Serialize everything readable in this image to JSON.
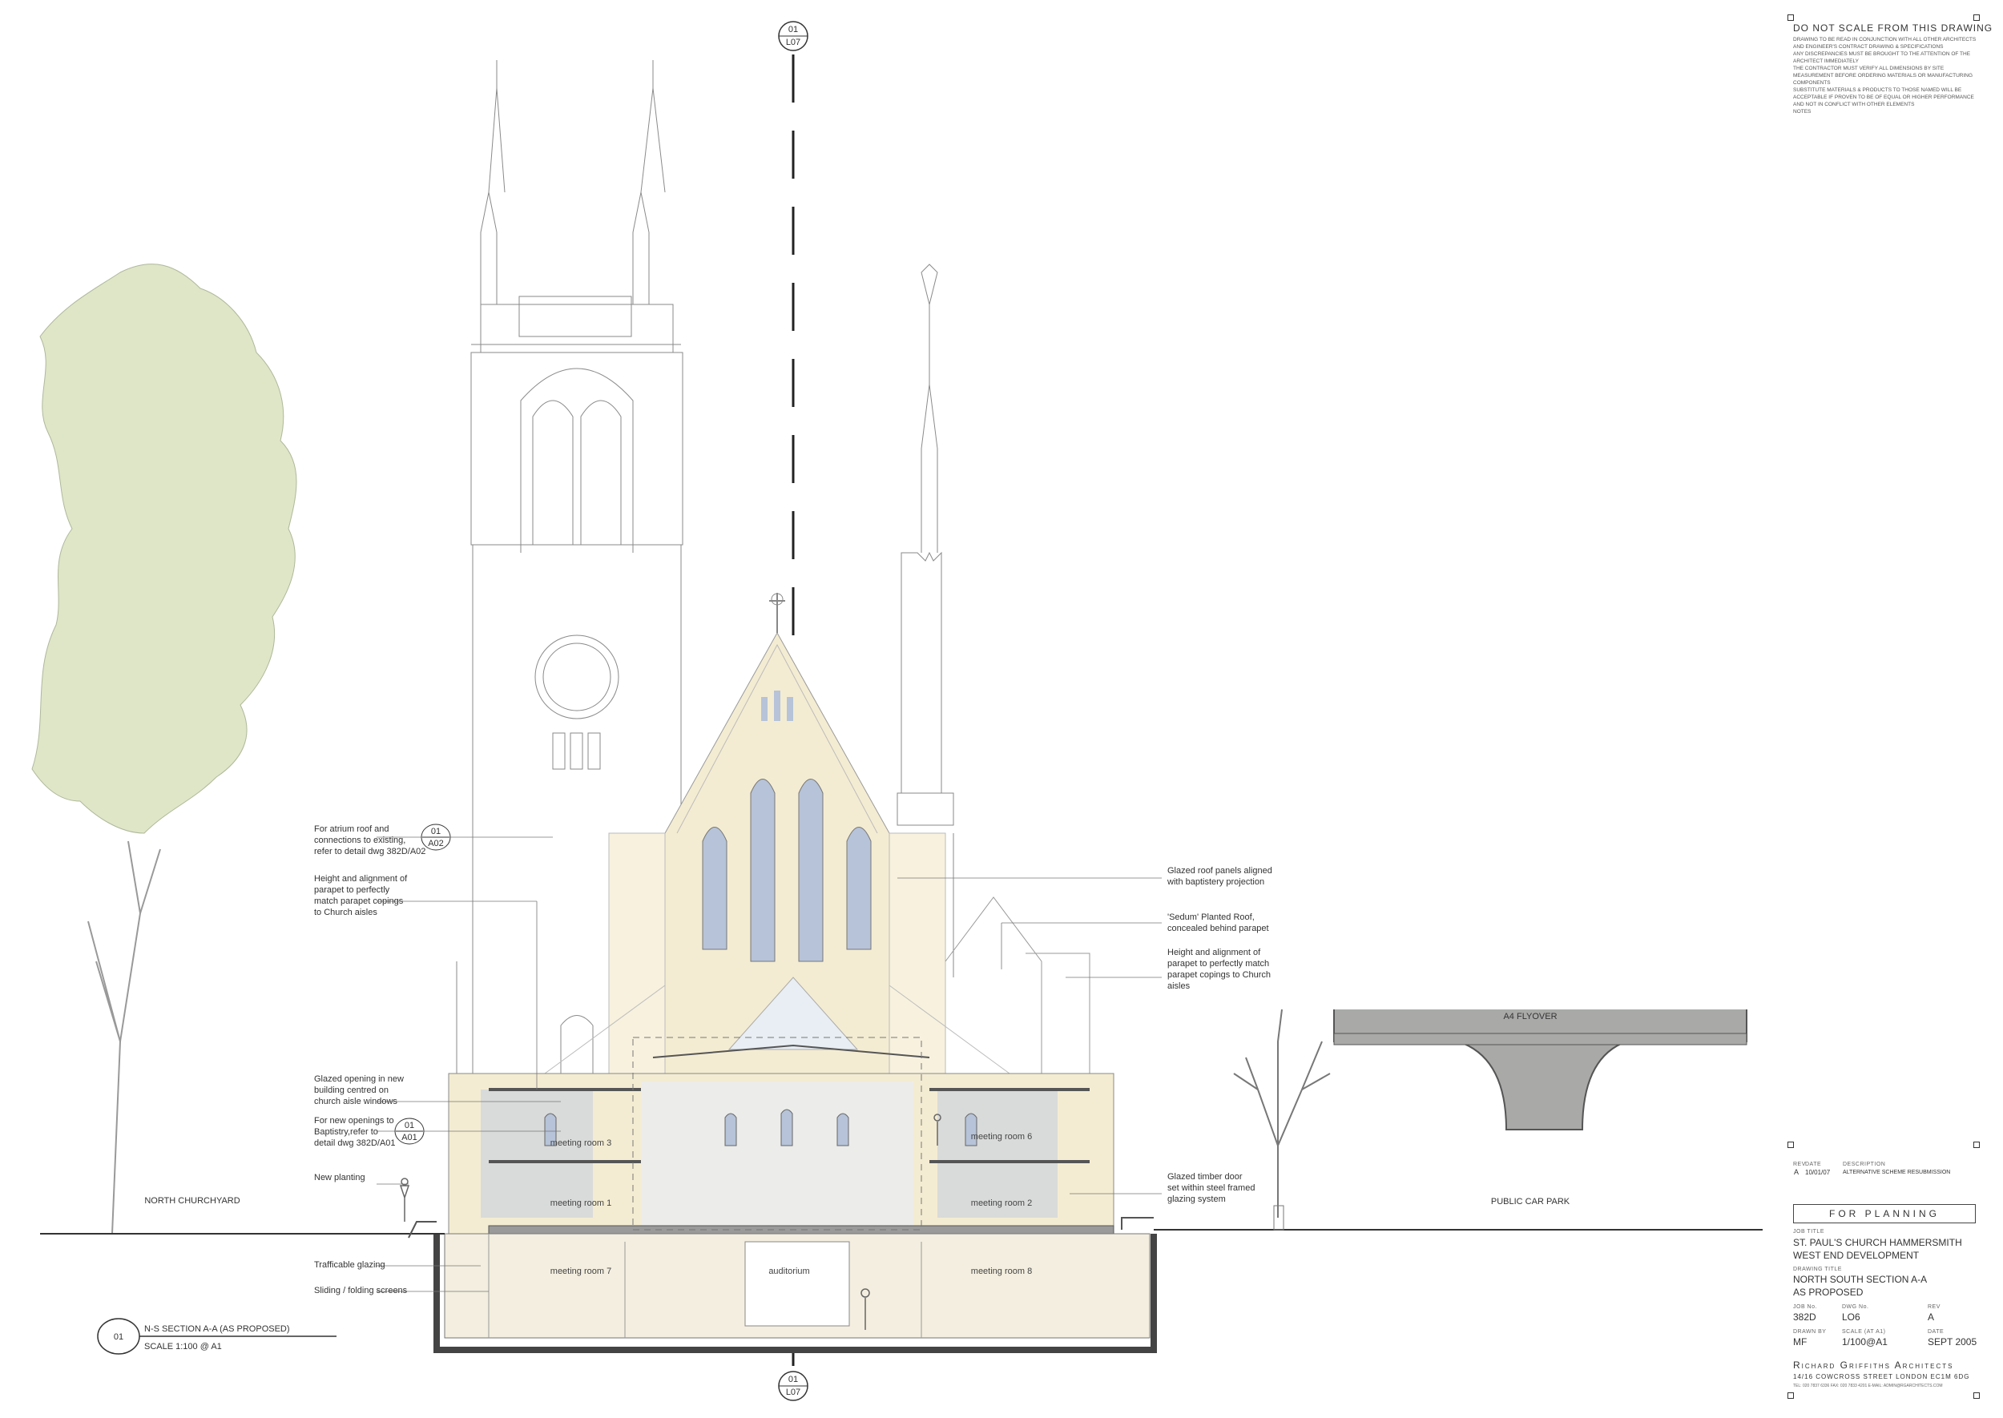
{
  "labels": {
    "atrium_note": "For atrium roof and\nconnections to existing,\nrefer to detail dwg 382D/A02",
    "parapet_note_left": "Height and alignment of\nparapet to perfectly\nmatch parapet copings\nto Church aisles",
    "glazed_opening_note": "Glazed opening in new\nbuilding centred on\nchurch aisle windows",
    "baptistry_note": "For new openings to\nBaptistry,refer to\ndetail dwg 382D/A01",
    "new_planting": "New planting",
    "trafficable_glazing": "Trafficable glazing",
    "sliding_screens": "Sliding / folding screens",
    "glazed_roof_note": "Glazed roof panels aligned\nwith baptistery projection",
    "sedum_note": "'Sedum' Planted Roof,\nconcealed behind parapet",
    "parapet_note_right": "Height and alignment of\nparapet to perfectly match\nparapet copings to Church\naisles",
    "timber_door_note": "Glazed timber door\nset within steel framed\nglazing system",
    "north_churchyard": "NORTH CHURCHYARD",
    "public_car_park": "PUBLIC CAR PARK",
    "a4_flyover": "A4 FLYOVER"
  },
  "rooms": {
    "meeting_room_3": "meeting room 3",
    "meeting_room_6": "meeting room 6",
    "meeting_room_1": "meeting room 1",
    "meeting_room_2": "meeting room 2",
    "meeting_room_7": "meeting room 7",
    "auditorium": "auditorium",
    "meeting_room_8": "meeting room 8"
  },
  "markers": {
    "top_num": "01",
    "top_ref": "L07",
    "bottom_num": "01",
    "bottom_ref": "L07",
    "atrium_num": "01",
    "atrium_ref": "A02",
    "baptistry_num": "01",
    "baptistry_ref": "A01"
  },
  "section": {
    "num": "01",
    "title": "N-S SECTION A-A  (AS PROPOSED)",
    "scale": "SCALE 1:100 @ A1"
  },
  "header_notes": {
    "title": "DO NOT SCALE FROM THIS DRAWING",
    "body": "DRAWING TO BE READ IN CONJUNCTION WITH ALL OTHER ARCHITECTS\nAND ENGINEER'S CONTRACT DRAWING & SPECIFICATIONS\nANY DISCREPANCIES MUST BE BROUGHT TO THE ATTENTION OF THE\nARCHITECT IMMEDIATELY\nTHE CONTRACTOR MUST VERIFY ALL DIMENSIONS BY SITE\nMEASUREMENT BEFORE ORDERING MATERIALS OR MANUFACTURING\nCOMPONENTS\nSUBSTITUTE MATERIALS & PRODUCTS TO THOSE NAMED WILL BE\nACCEPTABLE IF PROVEN TO BE OF EQUAL OR HIGHER PERFORMANCE\nAND NOT IN CONFLICT WITH OTHER ELEMENTS",
    "notes_label": "NOTES"
  },
  "revision": {
    "hdr_rev": "REV",
    "hdr_date": "DATE",
    "hdr_desc": "DESCRIPTION",
    "rev": "A",
    "date": "10/01/07",
    "desc": "ALTERNATIVE SCHEME RESUBMISSION"
  },
  "title_block": {
    "status": "FOR PLANNING",
    "job_title_label": "JOB TITLE",
    "job_title_1": "ST. PAUL'S CHURCH HAMMERSMITH",
    "job_title_2": "WEST END DEVELOPMENT",
    "drawing_title_label": "DRAWING TITLE",
    "drawing_title_1": "NORTH SOUTH SECTION A-A",
    "drawing_title_2": "AS PROPOSED",
    "job_no_label": "JOB No.",
    "job_no": "382D",
    "dwg_no_label": "DWG No.",
    "dwg_no": "LO6",
    "rev_label": "REV",
    "rev": "A",
    "drawn_by_label": "DRAWN BY",
    "drawn_by": "MF",
    "scale_label": "SCALE (AT A1)",
    "scale": "1/100@A1",
    "date_label": "DATE",
    "date": "SEPT 2005",
    "firm": "Richard Griffiths Architects",
    "address": "14/16 COWCROSS STREET LONDON EC1M 6DG",
    "contact": "TEL: 020 7837 6336  FAX: 020 7833 4201  E-MAIL: ADMIN@RGARCHITECTS.COM"
  },
  "colors": {
    "ink": "#4a4a4a",
    "stone": "#f4ecd2",
    "glass": "#b6c3d8",
    "tree": "#dfe6c8",
    "concrete": "#a9aaa8"
  }
}
